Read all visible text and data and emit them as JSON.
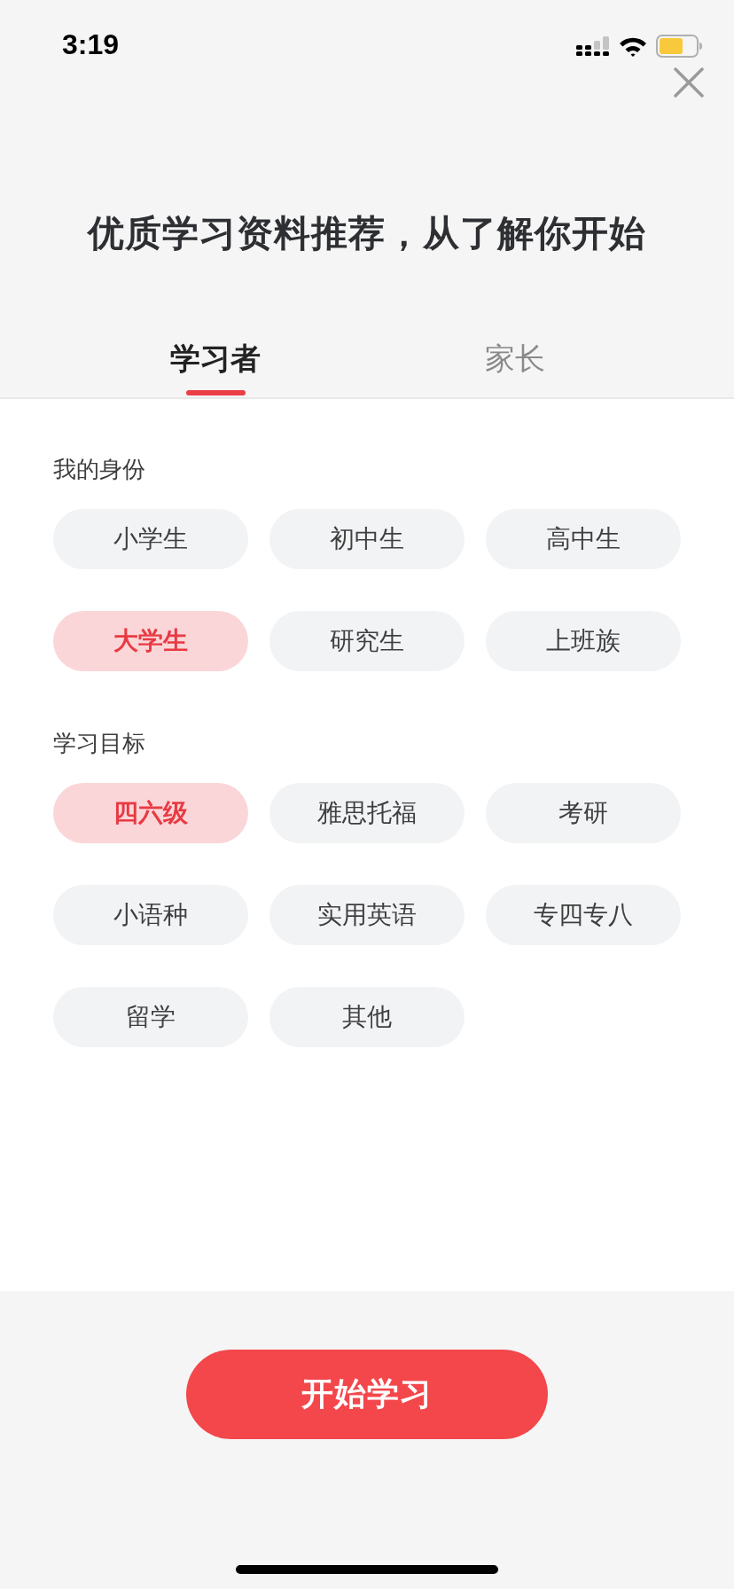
{
  "status_bar": {
    "time": "3:19"
  },
  "title": "优质学习资料推荐，从了解你开始",
  "tabs": [
    {
      "label": "学习者",
      "selected": true
    },
    {
      "label": "家长",
      "selected": false
    }
  ],
  "sections": [
    {
      "label": "我的身份",
      "options": [
        {
          "label": "小学生",
          "selected": false
        },
        {
          "label": "初中生",
          "selected": false
        },
        {
          "label": "高中生",
          "selected": false
        },
        {
          "label": "大学生",
          "selected": true
        },
        {
          "label": "研究生",
          "selected": false
        },
        {
          "label": "上班族",
          "selected": false
        }
      ]
    },
    {
      "label": "学习目标",
      "options": [
        {
          "label": "四六级",
          "selected": true
        },
        {
          "label": "雅思托福",
          "selected": false
        },
        {
          "label": "考研",
          "selected": false
        },
        {
          "label": "小语种",
          "selected": false
        },
        {
          "label": "实用英语",
          "selected": false
        },
        {
          "label": "专四专八",
          "selected": false
        },
        {
          "label": "留学",
          "selected": false
        },
        {
          "label": "其他",
          "selected": false
        }
      ]
    }
  ],
  "start_button": {
    "label": "开始学习"
  }
}
